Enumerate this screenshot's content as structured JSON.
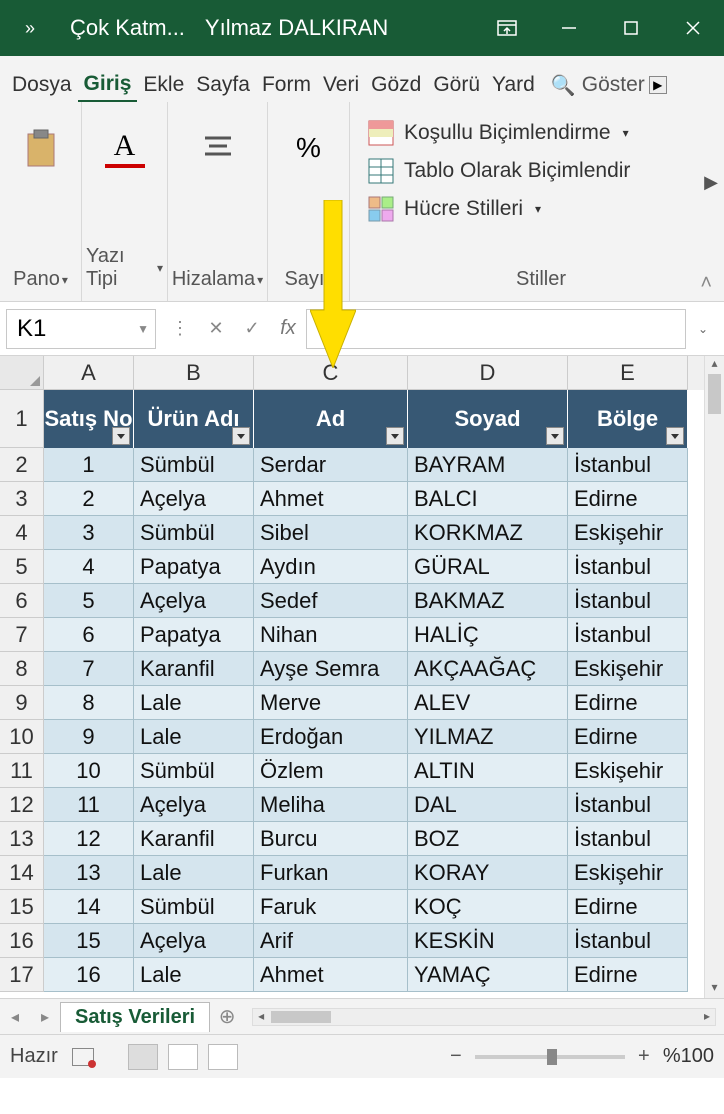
{
  "titlebar": {
    "qat_glyph": "»",
    "file_title": "Çok Katm...",
    "user": "Yılmaz DALKIRAN"
  },
  "tabs": {
    "items": [
      "Dosya",
      "Giriş",
      "Ekle",
      "Sayfa",
      "Form",
      "Veri",
      "Gözd",
      "Görü",
      "Yard"
    ],
    "active_index": 1,
    "tell_me": "Göster"
  },
  "ribbon": {
    "pano": "Pano",
    "yazi_tipi": "Yazı Tipi",
    "hizalama": "Hizalama",
    "sayi": "Sayı",
    "stiller_label": "Stiller",
    "style_items": {
      "cond": "Koşullu Biçimlendirme",
      "table": "Tablo Olarak Biçimlendir",
      "cell": "Hücre Stilleri"
    }
  },
  "formula_bar": {
    "name_box": "K1",
    "value": ""
  },
  "grid": {
    "columns": [
      "A",
      "B",
      "C",
      "D",
      "E"
    ],
    "headers": [
      "Satış No",
      "Ürün Adı",
      "Ad",
      "Soyad",
      "Bölge"
    ],
    "row_start": 1,
    "rows": [
      [
        "1",
        "Sümbül",
        "Serdar",
        "BAYRAM",
        "İstanbul"
      ],
      [
        "2",
        "Açelya",
        "Ahmet",
        "BALCI",
        "Edirne"
      ],
      [
        "3",
        "Sümbül",
        "Sibel",
        "KORKMAZ",
        "Eskişehir"
      ],
      [
        "4",
        "Papatya",
        "Aydın",
        "GÜRAL",
        "İstanbul"
      ],
      [
        "5",
        "Açelya",
        "Sedef",
        "BAKMAZ",
        "İstanbul"
      ],
      [
        "6",
        "Papatya",
        "Nihan",
        "HALİÇ",
        "İstanbul"
      ],
      [
        "7",
        "Karanfil",
        "Ayşe Semra",
        "AKÇAAĞAÇ",
        "Eskişehir"
      ],
      [
        "8",
        "Lale",
        "Merve",
        "ALEV",
        "Edirne"
      ],
      [
        "9",
        "Lale",
        "Erdoğan",
        "YILMAZ",
        "Edirne"
      ],
      [
        "10",
        "Sümbül",
        "Özlem",
        "ALTIN",
        "Eskişehir"
      ],
      [
        "11",
        "Açelya",
        "Meliha",
        "DAL",
        "İstanbul"
      ],
      [
        "12",
        "Karanfil",
        "Burcu",
        "BOZ",
        "İstanbul"
      ],
      [
        "13",
        "Lale",
        "Furkan",
        "KORAY",
        "Eskişehir"
      ],
      [
        "14",
        "Sümbül",
        "Faruk",
        "KOÇ",
        "Edirne"
      ],
      [
        "15",
        "Açelya",
        "Arif",
        "KESKİN",
        "İstanbul"
      ],
      [
        "16",
        "Lale",
        "Ahmet",
        "YAMAÇ",
        "Edirne"
      ]
    ]
  },
  "sheet_bar": {
    "active_sheet": "Satış Verileri"
  },
  "status": {
    "ready": "Hazır",
    "zoom": "%100"
  }
}
